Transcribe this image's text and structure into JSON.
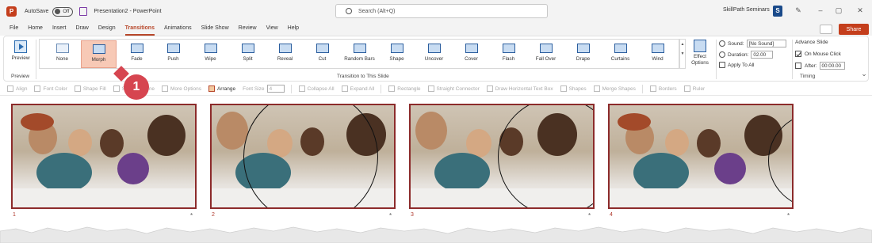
{
  "titlebar": {
    "logo": "P",
    "autosave_label": "AutoSave",
    "autosave_state": "Off",
    "doc_title": "Presentation2 - PowerPoint",
    "search_placeholder": "Search (Alt+Q)",
    "org_name": "SkillPath Seminars",
    "org_badge": "S"
  },
  "tabs": [
    "File",
    "Home",
    "Insert",
    "Draw",
    "Design",
    "Transitions",
    "Animations",
    "Slide Show",
    "Review",
    "View",
    "Help"
  ],
  "active_tab": "Transitions",
  "share_label": "Share",
  "ribbon": {
    "preview_label": "Preview",
    "preview_group": "Preview",
    "transitions_group": "Transition to This Slide",
    "transitions": [
      "None",
      "Morph",
      "Fade",
      "Push",
      "Wipe",
      "Split",
      "Reveal",
      "Cut",
      "Random Bars",
      "Shape",
      "Uncover",
      "Cover",
      "Flash",
      "Fall Over",
      "Drape",
      "Curtains",
      "Wind"
    ],
    "selected_transition": "Morph",
    "effect_options_line1": "Effect",
    "effect_options_line2": "Options",
    "sound_label": "Sound:",
    "sound_value": "[No Sound]",
    "duration_label": "Duration:",
    "duration_value": "02.00",
    "apply_all_label": "Apply To All",
    "advance_slide_label": "Advance Slide",
    "on_mouse_click_label": "On Mouse Click",
    "on_mouse_click_checked": true,
    "after_label": "After:",
    "after_value": "00:00.00",
    "after_checked": false,
    "timing_group": "Timing"
  },
  "quick_toolbar": [
    "Align",
    "Font Color",
    "Shape Fill",
    "Shape Outline",
    "More Options",
    "Arrange",
    "Font Size",
    "Collapse All",
    "Expand All",
    "Rectangle",
    "Straight Connector",
    "Draw Horizontal Text Box",
    "Shapes",
    "Merge Shapes",
    "Borders",
    "Ruler"
  ],
  "font_size_value": "4",
  "callout_number": "1",
  "slides": [
    {
      "number": "1",
      "star": "*"
    },
    {
      "number": "2",
      "star": "*"
    },
    {
      "number": "3",
      "star": "*"
    },
    {
      "number": "4",
      "star": "*"
    }
  ],
  "colors": {
    "accent": "#b7472a",
    "share": "#c43e1c",
    "selected_transition_bg": "#f7c9b6",
    "callout": "#d64550",
    "slide_border": "#8c2b2b"
  }
}
